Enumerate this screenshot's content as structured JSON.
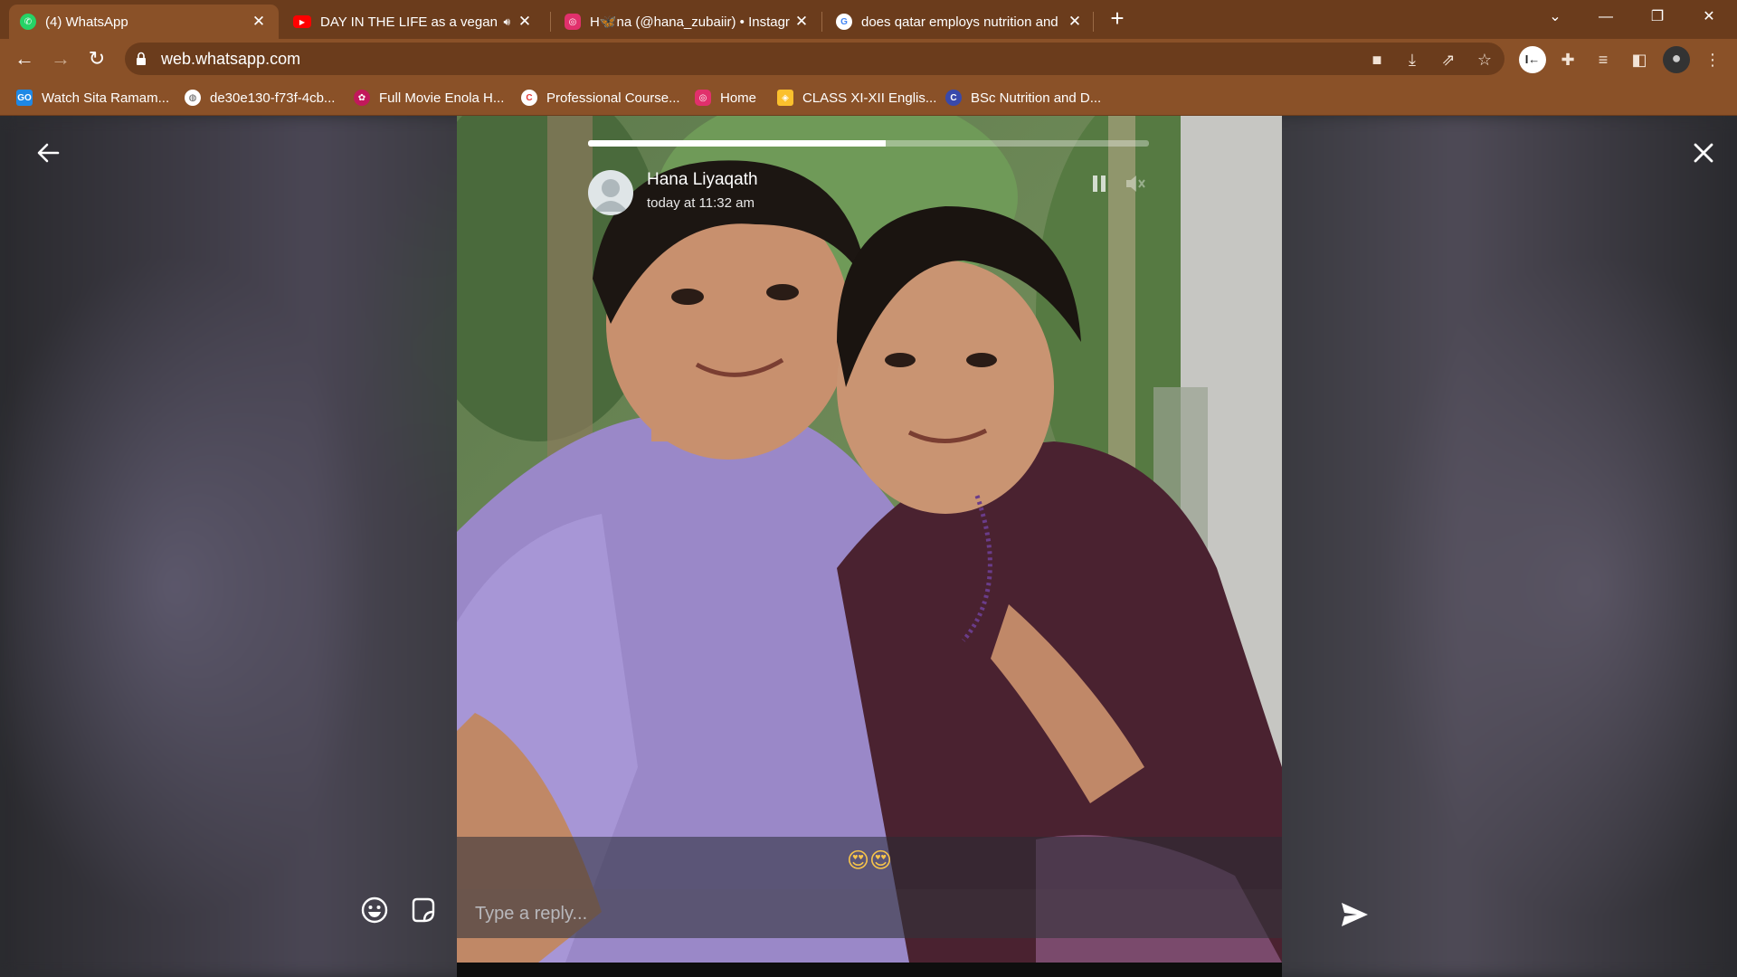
{
  "browser": {
    "tabs": [
      {
        "title": "(4) WhatsApp",
        "icon": "whatsapp-icon",
        "color": "#25d366",
        "active": true
      },
      {
        "title": "DAY IN THE LIFE as a vegan I",
        "icon": "youtube-icon",
        "color": "#ff0000",
        "active": false
      },
      {
        "title": "H🦋na (@hana_zubaiir) • Instagr",
        "icon": "instagram-icon",
        "color": "#e1306c",
        "active": false
      },
      {
        "title": "does qatar employs nutrition and",
        "icon": "google-icon",
        "color": "#ffffff",
        "active": false
      }
    ],
    "new_tab": "+",
    "url": "web.whatsapp.com",
    "bookmarks": [
      {
        "label": "Watch Sita Ramam...",
        "icon": "gomovies-icon",
        "color": "#1e88e5"
      },
      {
        "label": "de30e130-f73f-4cb...",
        "icon": "globe-icon",
        "color": "#555555"
      },
      {
        "label": "Full Movie Enola H...",
        "icon": "film-icon",
        "color": "#c2185b"
      },
      {
        "label": "Professional Course...",
        "icon": "course-icon",
        "color": "#e53935"
      },
      {
        "label": "Home",
        "icon": "instagram-icon",
        "color": "#e1306c"
      },
      {
        "label": "CLASS XI-XII Englis...",
        "icon": "class-icon",
        "color": "#fbc02d"
      },
      {
        "label": "BSc Nutrition and D...",
        "icon": "letter-c-icon",
        "color": "#3949ab"
      }
    ]
  },
  "status": {
    "contact_name": "Hana Liyaqath",
    "timestamp": "today at 11:32 am",
    "progress": 0.53,
    "caption": "😍😍",
    "reply_placeholder": "Type a reply..."
  },
  "colors": {
    "chrome_dark": "#6b3c1c",
    "chrome_light": "#8a5128",
    "accent": "#25d366"
  }
}
